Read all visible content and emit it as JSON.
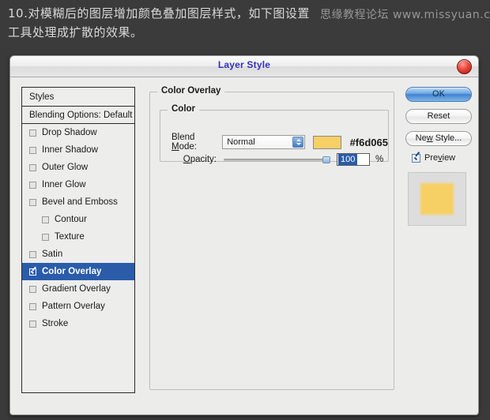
{
  "caption": {
    "line1": "10.对模糊后的图层增加颜色叠加图层样式，如下图设置",
    "line2": "工具处理成扩散的效果。",
    "watermark": "思缘教程论坛 www.missyuan.com"
  },
  "dialog": {
    "title": "Layer Style",
    "close_icon": "close-circle-icon"
  },
  "styles_panel": {
    "header": "Styles",
    "blending_options": "Blending Options: Default",
    "items": [
      {
        "label": "Drop Shadow",
        "checked": false,
        "indent": false,
        "selected": false
      },
      {
        "label": "Inner Shadow",
        "checked": false,
        "indent": false,
        "selected": false
      },
      {
        "label": "Outer Glow",
        "checked": false,
        "indent": false,
        "selected": false
      },
      {
        "label": "Inner Glow",
        "checked": false,
        "indent": false,
        "selected": false
      },
      {
        "label": "Bevel and Emboss",
        "checked": false,
        "indent": false,
        "selected": false
      },
      {
        "label": "Contour",
        "checked": false,
        "indent": true,
        "selected": false
      },
      {
        "label": "Texture",
        "checked": false,
        "indent": true,
        "selected": false
      },
      {
        "label": "Satin",
        "checked": false,
        "indent": false,
        "selected": false
      },
      {
        "label": "Color Overlay",
        "checked": true,
        "indent": false,
        "selected": true
      },
      {
        "label": "Gradient Overlay",
        "checked": false,
        "indent": false,
        "selected": false
      },
      {
        "label": "Pattern Overlay",
        "checked": false,
        "indent": false,
        "selected": false
      },
      {
        "label": "Stroke",
        "checked": false,
        "indent": false,
        "selected": false
      }
    ]
  },
  "main_panel": {
    "group_title": "Color Overlay",
    "color_group_title": "Color",
    "blend_mode_label": "Blend Mode:",
    "blend_mode_value": "Normal",
    "color_hex": "#f6d065",
    "opacity_label": "Opacity:",
    "opacity_value": "100",
    "percent_symbol": "%"
  },
  "buttons": {
    "ok": "OK",
    "reset": "Reset",
    "new_style": "New Style...",
    "preview_label": "Preview",
    "preview_checked": true
  },
  "colors": {
    "overlay_color": "#f6d065",
    "selection_blue": "#2a5caa",
    "title_blue": "#3030b8",
    "close_red": "#e8483c",
    "preview_bg": "#dddddd"
  }
}
